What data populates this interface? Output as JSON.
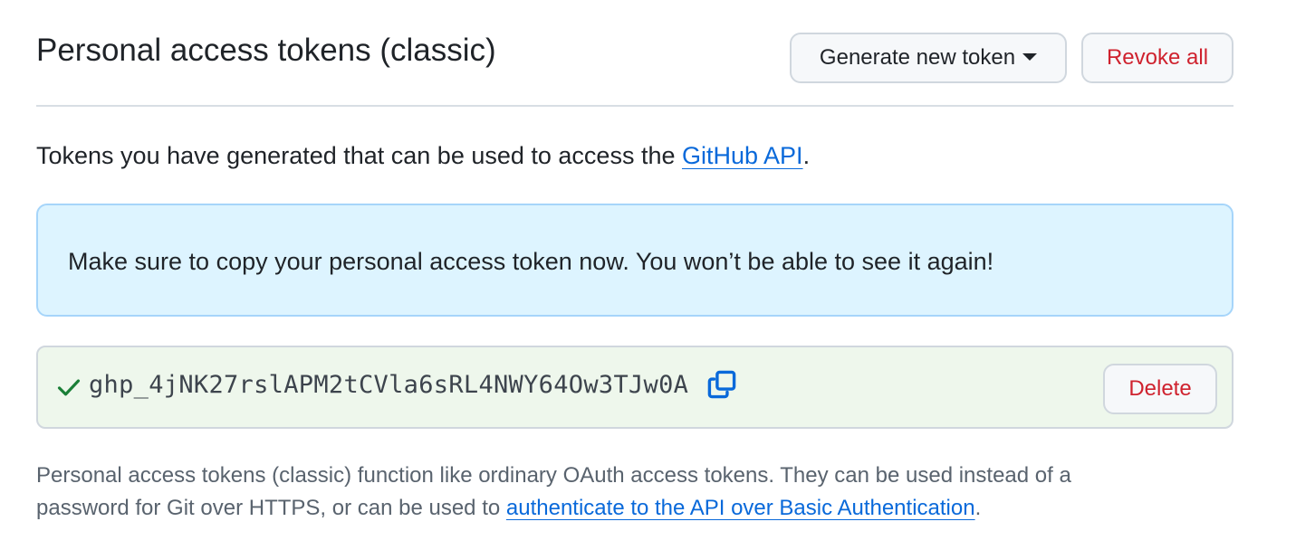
{
  "header": {
    "title": "Personal access tokens (classic)",
    "generate_label": "Generate new token",
    "revoke_label": "Revoke all"
  },
  "description": {
    "text_before": "Tokens you have generated that can be used to access the ",
    "link_text": "GitHub API",
    "text_after": "."
  },
  "flash": {
    "message": "Make sure to copy your personal access token now. You won’t be able to see it again!"
  },
  "token": {
    "value": "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",
    "delete_label": "Delete"
  },
  "footer": {
    "text_before": "Personal access tokens (classic) function like ordinary OAuth access tokens. They can be used instead of a password for Git over HTTPS, or can be used to ",
    "link_text": "authenticate to the API over Basic Authentication",
    "text_after": "."
  },
  "colors": {
    "link": "#0969da",
    "danger": "#cf222e",
    "flash_bg": "#ddf4ff",
    "token_bg": "#eef7ec",
    "check": "#1a7f37"
  },
  "icons": {
    "generate_dropdown": "caret-down-icon",
    "token_status": "check-icon",
    "copy": "copy-icon"
  }
}
